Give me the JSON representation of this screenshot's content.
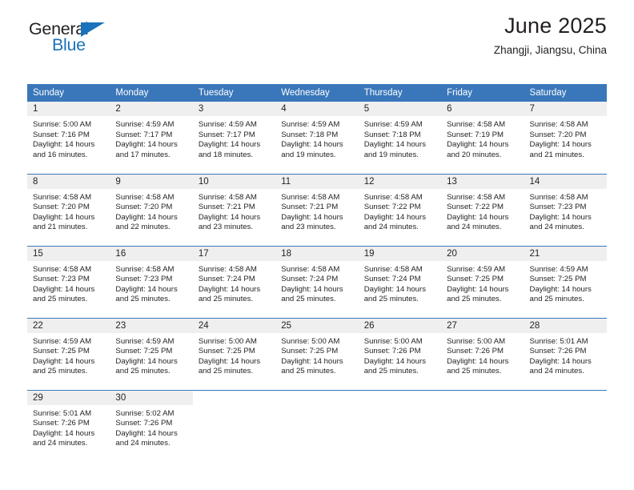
{
  "brand": {
    "name_part1": "General",
    "name_part2": "Blue",
    "triangle_color": "#1a72ba"
  },
  "header": {
    "title": "June 2025",
    "subtitle": "Zhangji, Jiangsu, China"
  },
  "calendar": {
    "accent_color": "#3a77ba",
    "daynum_background": "#efefef",
    "weekday_headers": [
      "Sunday",
      "Monday",
      "Tuesday",
      "Wednesday",
      "Thursday",
      "Friday",
      "Saturday"
    ],
    "weeks": [
      [
        {
          "day": "1",
          "sunrise": "Sunrise: 5:00 AM",
          "sunset": "Sunset: 7:16 PM",
          "daylight_line1": "Daylight: 14 hours",
          "daylight_line2": "and 16 minutes."
        },
        {
          "day": "2",
          "sunrise": "Sunrise: 4:59 AM",
          "sunset": "Sunset: 7:17 PM",
          "daylight_line1": "Daylight: 14 hours",
          "daylight_line2": "and 17 minutes."
        },
        {
          "day": "3",
          "sunrise": "Sunrise: 4:59 AM",
          "sunset": "Sunset: 7:17 PM",
          "daylight_line1": "Daylight: 14 hours",
          "daylight_line2": "and 18 minutes."
        },
        {
          "day": "4",
          "sunrise": "Sunrise: 4:59 AM",
          "sunset": "Sunset: 7:18 PM",
          "daylight_line1": "Daylight: 14 hours",
          "daylight_line2": "and 19 minutes."
        },
        {
          "day": "5",
          "sunrise": "Sunrise: 4:59 AM",
          "sunset": "Sunset: 7:18 PM",
          "daylight_line1": "Daylight: 14 hours",
          "daylight_line2": "and 19 minutes."
        },
        {
          "day": "6",
          "sunrise": "Sunrise: 4:58 AM",
          "sunset": "Sunset: 7:19 PM",
          "daylight_line1": "Daylight: 14 hours",
          "daylight_line2": "and 20 minutes."
        },
        {
          "day": "7",
          "sunrise": "Sunrise: 4:58 AM",
          "sunset": "Sunset: 7:20 PM",
          "daylight_line1": "Daylight: 14 hours",
          "daylight_line2": "and 21 minutes."
        }
      ],
      [
        {
          "day": "8",
          "sunrise": "Sunrise: 4:58 AM",
          "sunset": "Sunset: 7:20 PM",
          "daylight_line1": "Daylight: 14 hours",
          "daylight_line2": "and 21 minutes."
        },
        {
          "day": "9",
          "sunrise": "Sunrise: 4:58 AM",
          "sunset": "Sunset: 7:20 PM",
          "daylight_line1": "Daylight: 14 hours",
          "daylight_line2": "and 22 minutes."
        },
        {
          "day": "10",
          "sunrise": "Sunrise: 4:58 AM",
          "sunset": "Sunset: 7:21 PM",
          "daylight_line1": "Daylight: 14 hours",
          "daylight_line2": "and 23 minutes."
        },
        {
          "day": "11",
          "sunrise": "Sunrise: 4:58 AM",
          "sunset": "Sunset: 7:21 PM",
          "daylight_line1": "Daylight: 14 hours",
          "daylight_line2": "and 23 minutes."
        },
        {
          "day": "12",
          "sunrise": "Sunrise: 4:58 AM",
          "sunset": "Sunset: 7:22 PM",
          "daylight_line1": "Daylight: 14 hours",
          "daylight_line2": "and 24 minutes."
        },
        {
          "day": "13",
          "sunrise": "Sunrise: 4:58 AM",
          "sunset": "Sunset: 7:22 PM",
          "daylight_line1": "Daylight: 14 hours",
          "daylight_line2": "and 24 minutes."
        },
        {
          "day": "14",
          "sunrise": "Sunrise: 4:58 AM",
          "sunset": "Sunset: 7:23 PM",
          "daylight_line1": "Daylight: 14 hours",
          "daylight_line2": "and 24 minutes."
        }
      ],
      [
        {
          "day": "15",
          "sunrise": "Sunrise: 4:58 AM",
          "sunset": "Sunset: 7:23 PM",
          "daylight_line1": "Daylight: 14 hours",
          "daylight_line2": "and 25 minutes."
        },
        {
          "day": "16",
          "sunrise": "Sunrise: 4:58 AM",
          "sunset": "Sunset: 7:23 PM",
          "daylight_line1": "Daylight: 14 hours",
          "daylight_line2": "and 25 minutes."
        },
        {
          "day": "17",
          "sunrise": "Sunrise: 4:58 AM",
          "sunset": "Sunset: 7:24 PM",
          "daylight_line1": "Daylight: 14 hours",
          "daylight_line2": "and 25 minutes."
        },
        {
          "day": "18",
          "sunrise": "Sunrise: 4:58 AM",
          "sunset": "Sunset: 7:24 PM",
          "daylight_line1": "Daylight: 14 hours",
          "daylight_line2": "and 25 minutes."
        },
        {
          "day": "19",
          "sunrise": "Sunrise: 4:58 AM",
          "sunset": "Sunset: 7:24 PM",
          "daylight_line1": "Daylight: 14 hours",
          "daylight_line2": "and 25 minutes."
        },
        {
          "day": "20",
          "sunrise": "Sunrise: 4:59 AM",
          "sunset": "Sunset: 7:25 PM",
          "daylight_line1": "Daylight: 14 hours",
          "daylight_line2": "and 25 minutes."
        },
        {
          "day": "21",
          "sunrise": "Sunrise: 4:59 AM",
          "sunset": "Sunset: 7:25 PM",
          "daylight_line1": "Daylight: 14 hours",
          "daylight_line2": "and 25 minutes."
        }
      ],
      [
        {
          "day": "22",
          "sunrise": "Sunrise: 4:59 AM",
          "sunset": "Sunset: 7:25 PM",
          "daylight_line1": "Daylight: 14 hours",
          "daylight_line2": "and 25 minutes."
        },
        {
          "day": "23",
          "sunrise": "Sunrise: 4:59 AM",
          "sunset": "Sunset: 7:25 PM",
          "daylight_line1": "Daylight: 14 hours",
          "daylight_line2": "and 25 minutes."
        },
        {
          "day": "24",
          "sunrise": "Sunrise: 5:00 AM",
          "sunset": "Sunset: 7:25 PM",
          "daylight_line1": "Daylight: 14 hours",
          "daylight_line2": "and 25 minutes."
        },
        {
          "day": "25",
          "sunrise": "Sunrise: 5:00 AM",
          "sunset": "Sunset: 7:25 PM",
          "daylight_line1": "Daylight: 14 hours",
          "daylight_line2": "and 25 minutes."
        },
        {
          "day": "26",
          "sunrise": "Sunrise: 5:00 AM",
          "sunset": "Sunset: 7:26 PM",
          "daylight_line1": "Daylight: 14 hours",
          "daylight_line2": "and 25 minutes."
        },
        {
          "day": "27",
          "sunrise": "Sunrise: 5:00 AM",
          "sunset": "Sunset: 7:26 PM",
          "daylight_line1": "Daylight: 14 hours",
          "daylight_line2": "and 25 minutes."
        },
        {
          "day": "28",
          "sunrise": "Sunrise: 5:01 AM",
          "sunset": "Sunset: 7:26 PM",
          "daylight_line1": "Daylight: 14 hours",
          "daylight_line2": "and 24 minutes."
        }
      ],
      [
        {
          "day": "29",
          "sunrise": "Sunrise: 5:01 AM",
          "sunset": "Sunset: 7:26 PM",
          "daylight_line1": "Daylight: 14 hours",
          "daylight_line2": "and 24 minutes."
        },
        {
          "day": "30",
          "sunrise": "Sunrise: 5:02 AM",
          "sunset": "Sunset: 7:26 PM",
          "daylight_line1": "Daylight: 14 hours",
          "daylight_line2": "and 24 minutes."
        },
        {
          "day": "",
          "sunrise": "",
          "sunset": "",
          "daylight_line1": "",
          "daylight_line2": ""
        },
        {
          "day": "",
          "sunrise": "",
          "sunset": "",
          "daylight_line1": "",
          "daylight_line2": ""
        },
        {
          "day": "",
          "sunrise": "",
          "sunset": "",
          "daylight_line1": "",
          "daylight_line2": ""
        },
        {
          "day": "",
          "sunrise": "",
          "sunset": "",
          "daylight_line1": "",
          "daylight_line2": ""
        },
        {
          "day": "",
          "sunrise": "",
          "sunset": "",
          "daylight_line1": "",
          "daylight_line2": ""
        }
      ]
    ]
  }
}
